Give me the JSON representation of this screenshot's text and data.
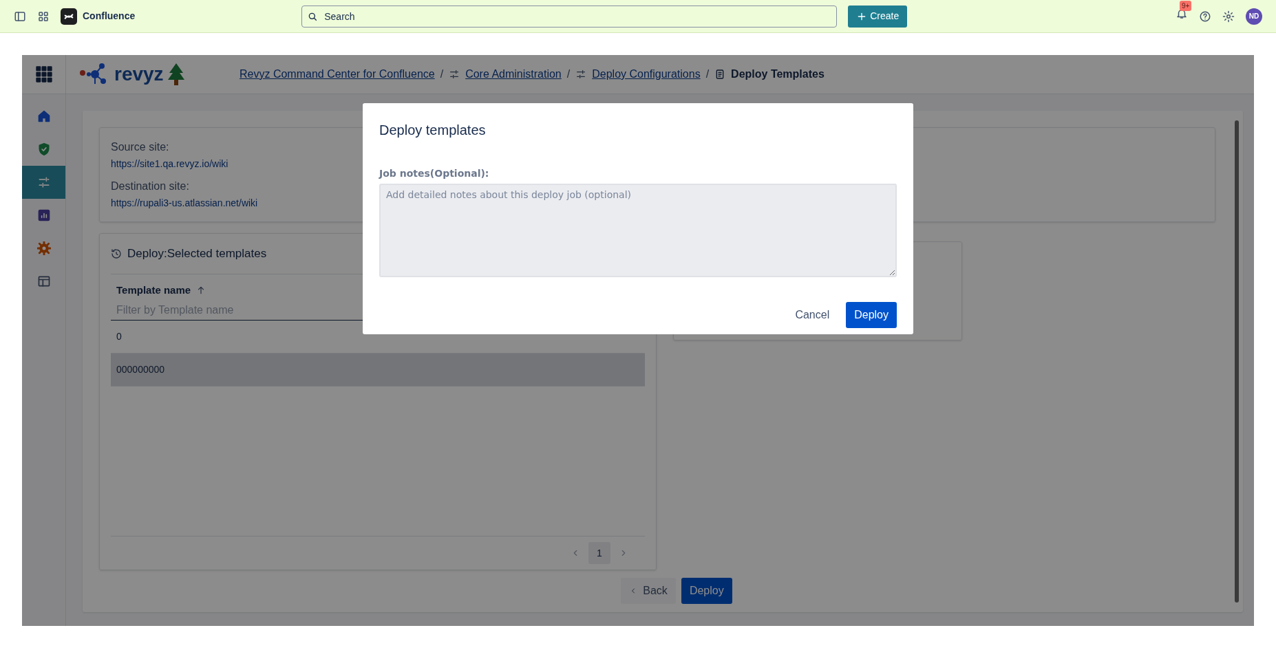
{
  "topbar": {
    "product": "Confluence",
    "search": {
      "placeholder": "Search"
    },
    "create_button": "Create",
    "notification_badge": "9+",
    "avatar": "ND"
  },
  "app": {
    "logo_text": "revyz",
    "breadcrumb_separator": "/",
    "breadcrumbs": [
      {
        "label": "Revyz Command Center for Confluence",
        "kind": "link"
      },
      {
        "label": "Core Administration",
        "kind": "link"
      },
      {
        "label": "Deploy Configurations",
        "kind": "link"
      },
      {
        "label": "Deploy Templates",
        "kind": "current"
      }
    ],
    "sidebar": {
      "items": [
        {
          "kind": "home",
          "selected": false
        },
        {
          "kind": "shield",
          "selected": false
        },
        {
          "kind": "sliders",
          "selected": true
        },
        {
          "kind": "chart",
          "selected": false
        },
        {
          "kind": "gear",
          "selected": false
        },
        {
          "kind": "table",
          "selected": false
        }
      ]
    },
    "sites": [
      {
        "label": "Source site:",
        "url": "https://site1.qa.revyz.io/wiki"
      },
      {
        "label": "Destination site:",
        "url": "https://rupali3-us.atlassian.net/wiki"
      }
    ],
    "table": {
      "title": "Deploy:Selected templates",
      "columns": [
        "Template name"
      ],
      "filter_placeholder": "Filter by Template name",
      "rows": [
        {
          "cells": [
            "0"
          ],
          "selected": false
        },
        {
          "cells": [
            "000000000"
          ],
          "selected": true
        }
      ],
      "pages": [
        {
          "label": "1",
          "selected": true
        }
      ]
    },
    "buttons": {
      "back": "Back",
      "deploy": "Deploy"
    }
  },
  "modal": {
    "title": "Deploy templates",
    "field_label": "Job notes(Optional):",
    "placeholder": "Add detailed notes about this deploy job (optional)",
    "cancel": "Cancel",
    "confirm": "Deploy"
  }
}
